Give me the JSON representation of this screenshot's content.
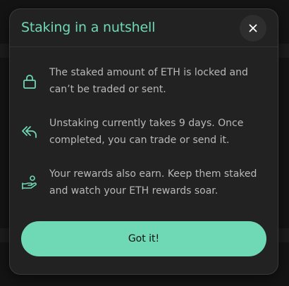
{
  "modal": {
    "title": "Staking in a nutshell",
    "close_icon": "close-icon",
    "items": [
      {
        "icon": "lock-icon",
        "text": "The staked amount of ETH is locked and can’t be traded or sent."
      },
      {
        "icon": "reply-all-icon",
        "text": "Unstaking currently takes 9 days. Once completed, you can trade or send it."
      },
      {
        "icon": "hand-coins-icon",
        "text": "Your rewards also earn. Keep them staked and watch your ETH rewards soar."
      }
    ],
    "confirm_label": "Got it!"
  },
  "colors": {
    "accent": "#6fd8b4",
    "modal_bg": "#222222",
    "text_muted": "#b9b9b9"
  }
}
